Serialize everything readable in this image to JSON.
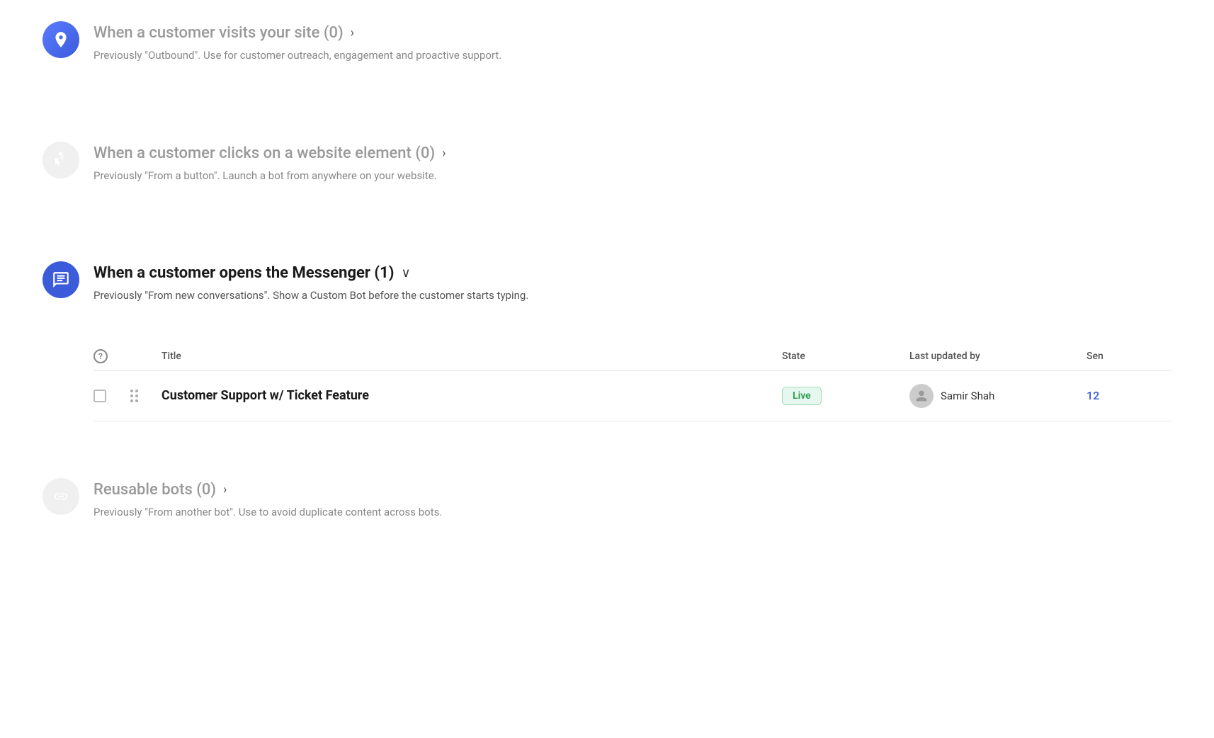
{
  "sections": {
    "visits": {
      "title": "When a customer visits your site (0)",
      "chevron": "›",
      "description": "Previously \"Outbound\". Use for customer outreach, engagement and proactive support.",
      "icon_type": "blue_gradient"
    },
    "clicks": {
      "title": "When a customer clicks on a website element (0)",
      "chevron": "›",
      "description": "Previously \"From a button\". Launch a bot from anywhere on your website.",
      "icon_type": "gray"
    },
    "messenger": {
      "title": "When a customer opens the Messenger (1)",
      "chevron": "∨",
      "description": "Previously \"From new conversations\". Show a Custom Bot before the customer starts typing.",
      "icon_type": "blue_filled"
    },
    "reusable": {
      "title": "Reusable bots (0)",
      "chevron": "›",
      "description": "Previously \"From another bot\". Use to avoid duplicate content across bots.",
      "icon_type": "gray"
    }
  },
  "table": {
    "headers": {
      "help_label": "?",
      "title_label": "Title",
      "state_label": "State",
      "updated_label": "Last updated by",
      "sent_label": "Sen"
    },
    "rows": [
      {
        "id": "row1",
        "title": "Customer Support w/ Ticket Feature",
        "state": "Live",
        "state_type": "live",
        "updated_by": "Samir Shah",
        "sent_count": "12"
      }
    ]
  }
}
